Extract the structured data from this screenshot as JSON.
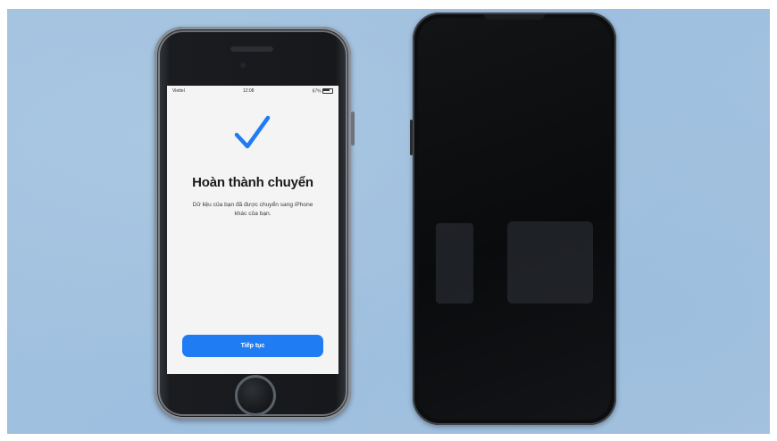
{
  "left_phone": {
    "status_bar": {
      "carrier": "Viettel",
      "time": "12:08",
      "battery": "67%"
    },
    "screen": {
      "title": "Hoàn thành chuyển",
      "description": "Dữ liệu của bạn đã được chuyển sang iPhone khác của bạn.",
      "continue_button": "Tiếp tục"
    },
    "colors": {
      "accent": "#1f7cf2",
      "screen_bg": "#f4f4f5"
    }
  },
  "right_phone": {
    "state": "screen-off"
  },
  "background_color": "#a2c1df"
}
